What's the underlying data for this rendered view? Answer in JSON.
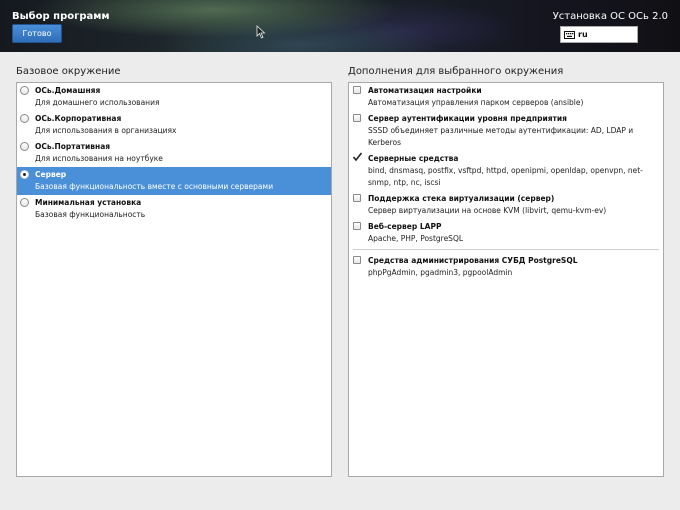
{
  "header": {
    "title": "Выбор программ",
    "done_label": "Готово",
    "install_title": "Установка ОС ОСь 2.0",
    "keyboard_layout": "ru"
  },
  "left_panel": {
    "title": "Базовое окружение",
    "items": [
      {
        "name": "ОСь.Домашняя",
        "desc": "Для домашнего использования",
        "selected": false
      },
      {
        "name": "ОСь.Корпоративная",
        "desc": "Для использования в организациях",
        "selected": false
      },
      {
        "name": "ОСь.Портативная",
        "desc": "Для использования на ноутбуке",
        "selected": false
      },
      {
        "name": "Сервер",
        "desc": "Базовая функциональность вместе с основными серверами",
        "selected": true
      },
      {
        "name": "Минимальная установка",
        "desc": "Базовая функциональность",
        "selected": false
      }
    ]
  },
  "right_panel": {
    "title": "Дополнения для выбранного окружения",
    "items": [
      {
        "name": "Автоматизация настройки",
        "desc": "Автоматизация управления парком серверов (ansible)",
        "checked": false
      },
      {
        "name": "Сервер аутентификации уровня предприятия",
        "desc": "SSSD объединяет различные методы аутентификации: AD, LDAP и Kerberos",
        "checked": false
      },
      {
        "name": "Серверные средства",
        "desc": "bind, dnsmasq, postfix, vsftpd, httpd, openipmi, openldap, openvpn, net-snmp, ntp, nc, iscsi",
        "checked": true
      },
      {
        "name": "Поддержка стека виртуализации (сервер)",
        "desc": "Сервер виртуализации на основе KVM (libvirt, qemu-kvm-ev)",
        "checked": false
      },
      {
        "name": "Веб-сервер LAPP",
        "desc": "Apache, PHP, PostgreSQL",
        "checked": false
      },
      {
        "name": "Средства администрирования СУБД PostgreSQL",
        "desc": "phpPgAdmin, pgadmin3, pgpoolAdmin",
        "checked": false
      }
    ]
  },
  "colors": {
    "selection": "#4a90d9",
    "button": "#3a7cc8"
  }
}
